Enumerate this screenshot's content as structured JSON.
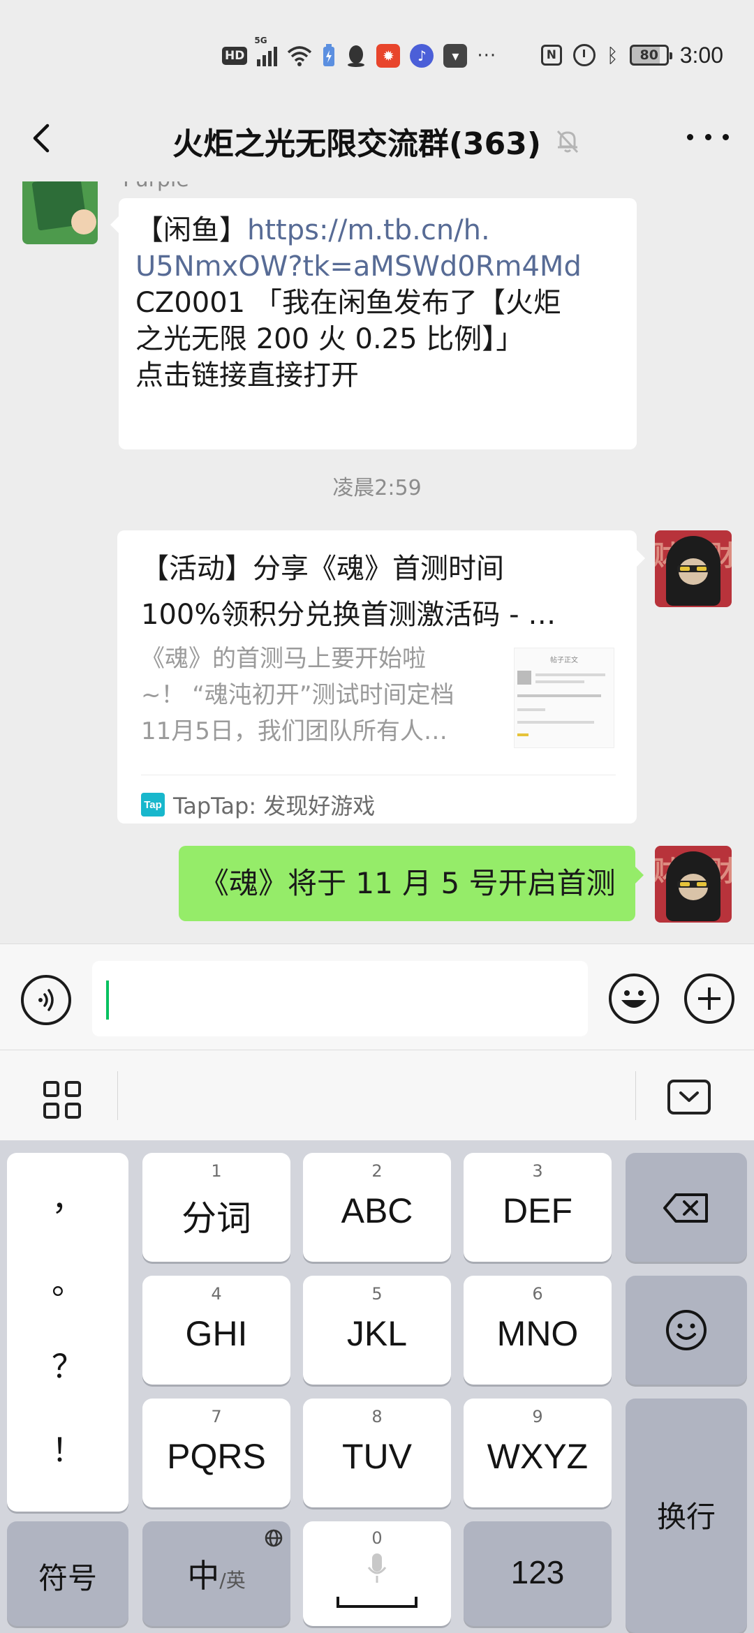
{
  "status_bar": {
    "network_label": "HD",
    "network_gen": "5G",
    "battery": "80",
    "time": "3:00",
    "nfc": "N"
  },
  "nav": {
    "title": "火炬之光无限交流群(363)"
  },
  "messages": {
    "sender_name": "Purple",
    "first_text_prefix": "【闲鱼】",
    "first_link": "https://m.tb.cn/h.U5NmxOW?tk=aMSWd0Rm4Md",
    "first_link_line1": "https://m.tb.cn/h.",
    "first_link_line2": "U5NmxOW?tk=aMSWd0Rm4Md",
    "first_line3": "CZ0001 「我在闲鱼发布了【火炬",
    "first_line4": "之光无限 200 火 0.25 比例】」",
    "first_line5": "点击链接直接打开",
    "timestamp": "凌晨2:59",
    "card_title_line1": "【活动】分享《魂》首测时间",
    "card_title_line2": "100%领积分兑换首测激活码 - …",
    "card_desc_line1": "《魂》的首测马上要开始啦",
    "card_desc_line2": "~！ “魂沌初开”测试时间定档",
    "card_desc_line3": "11月5日，我们团队所有人…",
    "card_thumb_title": "帖子正文",
    "card_source_icon": "Tap",
    "card_source": "TapTap: 发现好游戏",
    "green_text": "《魂》将于 11 月 5 号开启首测",
    "avatar_text": "财"
  },
  "keyboard": {
    "punctuation": [
      "，",
      "。",
      "？",
      "！"
    ],
    "keys": [
      {
        "num": "1",
        "label": "分词"
      },
      {
        "num": "2",
        "label": "ABC"
      },
      {
        "num": "3",
        "label": "DEF"
      },
      {
        "num": "4",
        "label": "GHI"
      },
      {
        "num": "5",
        "label": "JKL"
      },
      {
        "num": "6",
        "label": "MNO"
      },
      {
        "num": "7",
        "label": "PQRS"
      },
      {
        "num": "8",
        "label": "TUV"
      },
      {
        "num": "9",
        "label": "WXYZ"
      }
    ],
    "symbols": "符号",
    "lang_main": "中",
    "lang_alt": "/英",
    "space_num": "0",
    "numbers": "123",
    "enter": "换行"
  },
  "colors": {
    "accent_green": "#07c160",
    "bubble_green": "#95ec69",
    "link_blue": "#576b95",
    "background": "#ededed"
  }
}
